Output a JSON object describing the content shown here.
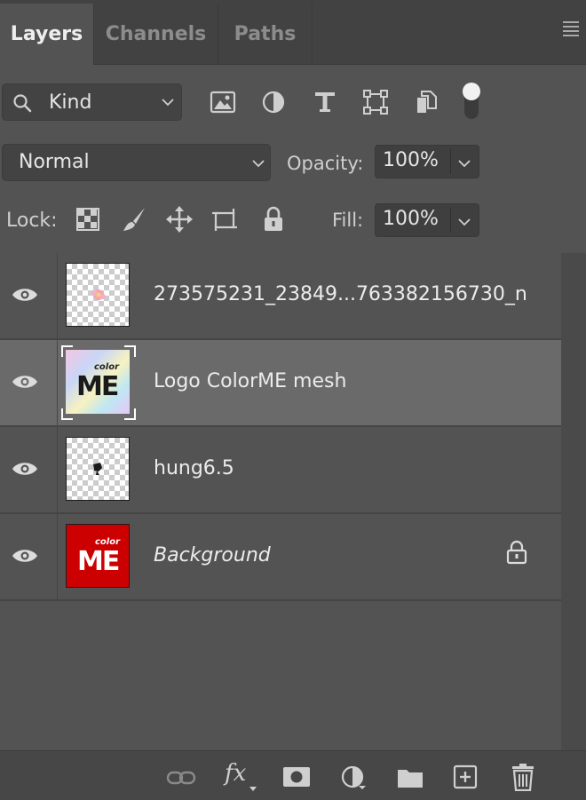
{
  "tabs": [
    {
      "label": "Layers",
      "active": true
    },
    {
      "label": "Channels",
      "active": false
    },
    {
      "label": "Paths",
      "active": false
    }
  ],
  "filter": {
    "kind_label": "Kind",
    "icons": [
      "image-filter-icon",
      "adjustment-filter-icon",
      "type-filter-icon",
      "shape-filter-icon",
      "smart-object-filter-icon",
      "filter-toggle-icon"
    ]
  },
  "blend": {
    "mode": "Normal",
    "opacity_label": "Opacity:",
    "opacity_value": "100%",
    "fill_label": "Fill:",
    "fill_value": "100%"
  },
  "lock": {
    "label": "Lock:",
    "icons": [
      "lock-transparent-pixels-icon",
      "lock-image-pixels-icon",
      "lock-position-icon",
      "lock-artboard-icon",
      "lock-all-icon"
    ]
  },
  "layers": [
    {
      "name": "273575231_23849...763382156730_n",
      "visible": true,
      "selected": false,
      "thumb": "transparent-flower"
    },
    {
      "name": "Logo ColorME mesh",
      "visible": true,
      "selected": true,
      "thumb": "gradient-logo",
      "thumb_text_top": "color",
      "thumb_text_main": "ME"
    },
    {
      "name": "hung6.5",
      "visible": true,
      "selected": false,
      "thumb": "transparent-figure"
    },
    {
      "name": "Background",
      "visible": true,
      "selected": false,
      "locked": true,
      "thumb": "red-logo",
      "thumb_text_top": "color",
      "thumb_text_main": "ME"
    }
  ],
  "bottom_bar": {
    "icons": [
      "link-layers-icon",
      "layer-style-fx-icon",
      "add-mask-icon",
      "new-adjustment-layer-icon",
      "new-group-icon",
      "new-layer-icon",
      "delete-layer-icon"
    ],
    "fx_text": "fx"
  },
  "colors": {
    "panel_bg": "#535353",
    "tab_bg": "#424242",
    "selected_row": "#6a6a6a",
    "background_thumb_red": "#cc0000"
  }
}
